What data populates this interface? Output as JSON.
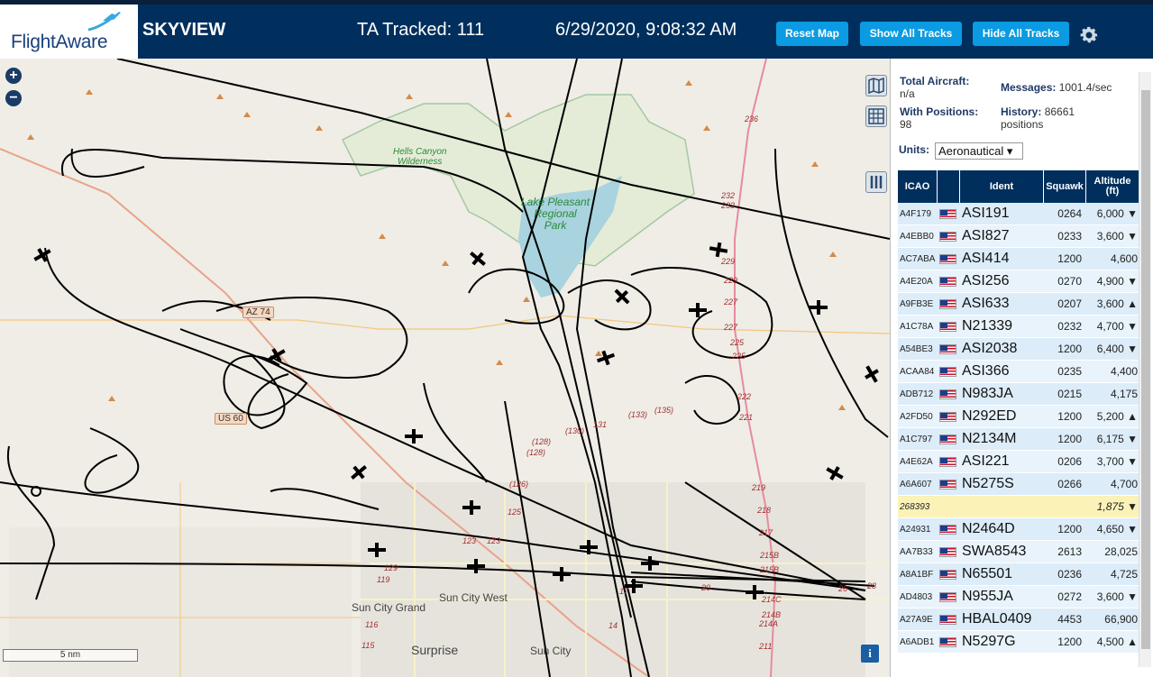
{
  "header": {
    "logo_text": "FlightAware",
    "app_title": "SKYVIEW",
    "tracked_label": "TA Tracked: 111",
    "clock": "6/29/2020, 9:08:32 AM",
    "buttons": {
      "reset": "Reset Map",
      "show_all": "Show All Tracks",
      "hide_all": "Hide All Tracks"
    },
    "settings_icon": "gear-icon"
  },
  "map": {
    "zoom_in": "+",
    "zoom_out": "−",
    "scale_label": "5 nm",
    "info_label": "i",
    "labels": {
      "hells_canyon": "Hells Canyon\nWilderness",
      "lake_pleasant": "Lake Pleasant\nRegional\nPark",
      "az74": "AZ 74",
      "us60": "US 60",
      "sun_city_grand": "Sun City Grand",
      "sun_city_west": "Sun City West",
      "surprise": "Surprise",
      "sun_city": "Sun City"
    },
    "highway_numbers": [
      "236",
      "232",
      "233",
      "229",
      "229",
      "227",
      "227",
      "225",
      "225",
      "222",
      "221",
      "219",
      "218",
      "217",
      "215B",
      "215B",
      "214C",
      "214B",
      "214A",
      "211",
      "(133)",
      "(135)",
      "(130)",
      "131",
      "(128)",
      "(128)",
      "(126)",
      "125",
      "123",
      "123",
      "129",
      "119",
      "116",
      "115",
      "14",
      "17",
      "20",
      "26",
      "28"
    ],
    "colors": {
      "background": "#efede6",
      "water": "#a9d3de",
      "track": "#000000",
      "park_border": "#9cc49c",
      "highway": "#e88aa0"
    }
  },
  "sidebar": {
    "total_aircraft_label": "Total Aircraft:",
    "total_aircraft_value": "n/a",
    "with_positions_label": "With Positions:",
    "with_positions_value": "98",
    "messages_label": "Messages:",
    "messages_value": "1001.4/sec",
    "history_label": "History:",
    "history_value": "86661",
    "history_unit": "positions",
    "units_label": "Units:",
    "units_value": "Aeronautical ▾",
    "columns": {
      "icao": "ICAO",
      "ident": "Ident",
      "squawk": "Squawk",
      "altitude": "Altitude (ft)"
    },
    "rows": [
      {
        "icao": "A4F179",
        "ident": "ASI191",
        "squawk": "0264",
        "alt": "6,000 ▼",
        "flag": true
      },
      {
        "icao": "A4EBB0",
        "ident": "ASI827",
        "squawk": "0233",
        "alt": "3,600 ▼",
        "flag": true
      },
      {
        "icao": "AC7ABA",
        "ident": "ASI414",
        "squawk": "1200",
        "alt": "4,600",
        "flag": true
      },
      {
        "icao": "A4E20A",
        "ident": "ASI256",
        "squawk": "0270",
        "alt": "4,900 ▼",
        "flag": true
      },
      {
        "icao": "A9FB3E",
        "ident": "ASI633",
        "squawk": "0207",
        "alt": "3,600 ▲",
        "flag": true
      },
      {
        "icao": "A1C78A",
        "ident": "N21339",
        "squawk": "0232",
        "alt": "4,700 ▼",
        "flag": true
      },
      {
        "icao": "A54BE3",
        "ident": "ASI2038",
        "squawk": "1200",
        "alt": "6,400 ▼",
        "flag": true
      },
      {
        "icao": "ACAA84",
        "ident": "ASI366",
        "squawk": "0235",
        "alt": "4,400",
        "flag": true
      },
      {
        "icao": "ADB712",
        "ident": "N983JA",
        "squawk": "0215",
        "alt": "4,175",
        "flag": true
      },
      {
        "icao": "A2FD50",
        "ident": "N292ED",
        "squawk": "1200",
        "alt": "5,200 ▲",
        "flag": true
      },
      {
        "icao": "A1C797",
        "ident": "N2134M",
        "squawk": "1200",
        "alt": "6,175 ▼",
        "flag": true
      },
      {
        "icao": "A4E62A",
        "ident": "ASI221",
        "squawk": "0206",
        "alt": "3,700 ▼",
        "flag": true
      },
      {
        "icao": "A6A607",
        "ident": "N5275S",
        "squawk": "0266",
        "alt": "4,700",
        "flag": true
      },
      {
        "icao": "268393",
        "ident": "",
        "squawk": "",
        "alt": "1,875 ▼",
        "flag": false,
        "highlight": true
      },
      {
        "icao": "A24931",
        "ident": "N2464D",
        "squawk": "1200",
        "alt": "4,650 ▼",
        "flag": true
      },
      {
        "icao": "AA7B33",
        "ident": "SWA8543",
        "squawk": "2613",
        "alt": "28,025",
        "flag": true
      },
      {
        "icao": "A8A1BF",
        "ident": "N65501",
        "squawk": "0236",
        "alt": "4,725",
        "flag": true
      },
      {
        "icao": "AD4803",
        "ident": "N955JA",
        "squawk": "0272",
        "alt": "3,600 ▼",
        "flag": true
      },
      {
        "icao": "A27A9E",
        "ident": "HBAL0409",
        "squawk": "4453",
        "alt": "66,900",
        "flag": true
      },
      {
        "icao": "A6ADB1",
        "ident": "N5297G",
        "squawk": "1200",
        "alt": "4,500 ▲",
        "flag": true
      }
    ]
  }
}
